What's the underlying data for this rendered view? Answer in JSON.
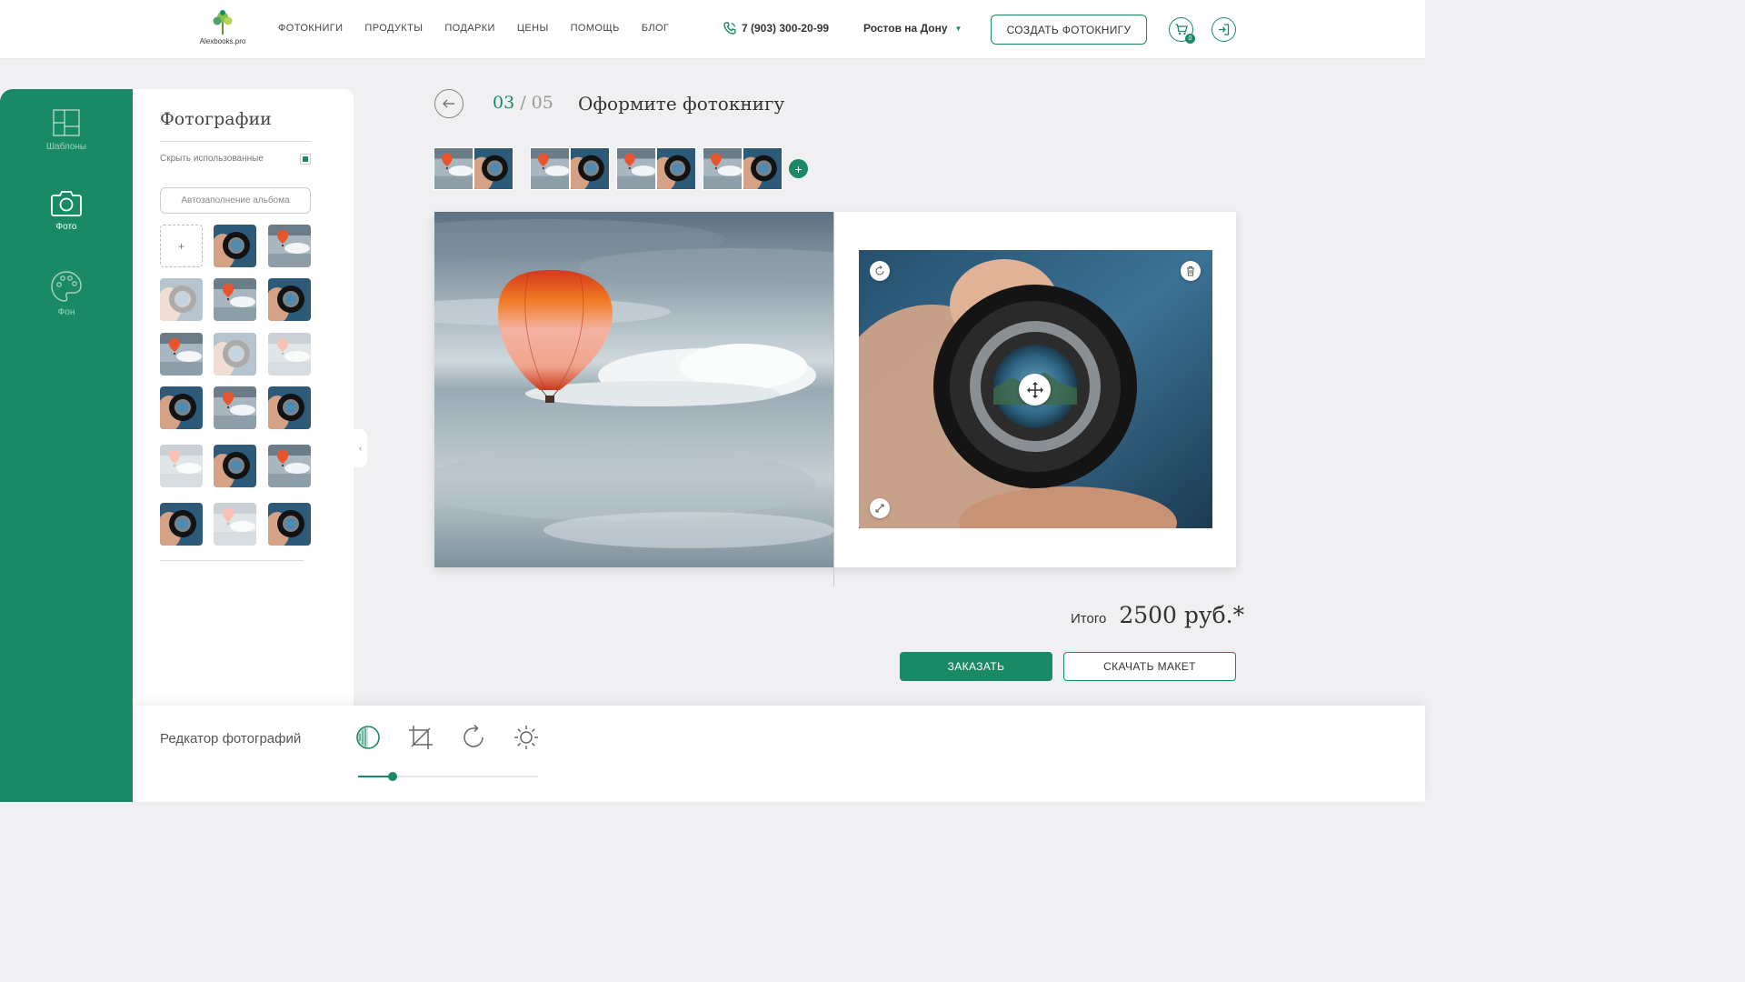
{
  "header": {
    "logo_text": "Alexbooks.pro",
    "nav": [
      "ФОТОКНИГИ",
      "ПРОДУКТЫ",
      "ПОДАРКИ",
      "ЦЕНЫ",
      "ПОМОЩЬ",
      "БЛОГ"
    ],
    "phone": "7 (903) 300-20-99",
    "city": "Ростов на Дону",
    "create_button": "СОЗДАТЬ ФОТОКНИГУ",
    "cart_badge": "0"
  },
  "rail": {
    "items": [
      {
        "label": "Шаблоны",
        "icon": "templates-icon",
        "active": false
      },
      {
        "label": "Фото",
        "icon": "camera-icon",
        "active": true
      },
      {
        "label": "Фон",
        "icon": "palette-icon",
        "active": false
      }
    ]
  },
  "panel": {
    "title": "Фотографии",
    "hide_used_label": "Скрыть использованные",
    "hide_used_checked": true,
    "autofill_button": "Автозаполнение альбома",
    "add_label": "+",
    "thumbnails": [
      {
        "kind": "lens",
        "faded": false
      },
      {
        "kind": "balloon",
        "faded": false
      },
      {
        "kind": "lens",
        "faded": true
      },
      {
        "kind": "balloon",
        "faded": false
      },
      {
        "kind": "lens",
        "faded": false
      },
      {
        "kind": "balloon",
        "faded": false
      },
      {
        "kind": "lens",
        "faded": true
      },
      {
        "kind": "balloon",
        "faded": true
      },
      {
        "kind": "lens",
        "faded": false
      },
      {
        "kind": "balloon",
        "faded": false
      },
      {
        "kind": "lens",
        "faded": false
      },
      {
        "kind": "balloon",
        "faded": true
      },
      {
        "kind": "lens",
        "faded": false
      },
      {
        "kind": "balloon",
        "faded": false
      },
      {
        "kind": "lens",
        "faded": false
      },
      {
        "kind": "balloon",
        "faded": true
      },
      {
        "kind": "lens",
        "faded": false
      }
    ]
  },
  "main": {
    "step_current": "03",
    "step_separator": " / ",
    "step_total": "05",
    "title": "Оформите фотокнигу",
    "spreads_count": 4,
    "total_label": "Итого",
    "total_price": "2500 руб.*",
    "order_button": "ЗАКАЗАТЬ",
    "download_button": "СКАЧАТЬ МАКЕТ"
  },
  "editor": {
    "title": "Редкатор фотографий",
    "tools": [
      "contrast-icon",
      "crop-icon",
      "rotate-icon",
      "brightness-icon"
    ],
    "active_tool": "contrast-icon",
    "slider_value": 0.19
  },
  "colors": {
    "accent": "#1a8a66",
    "background": "#f0f0f2"
  }
}
